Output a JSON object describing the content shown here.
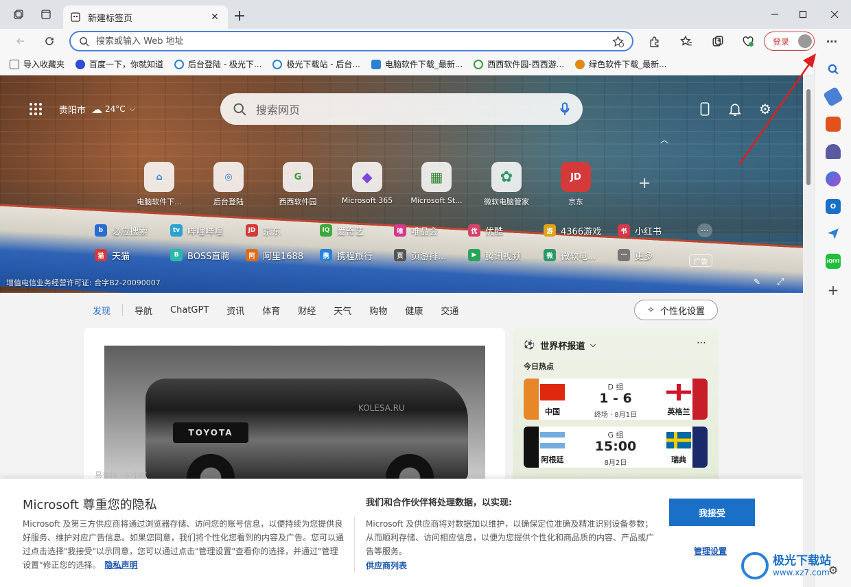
{
  "window": {
    "tab_title": "新建标签页",
    "new_tab": "+"
  },
  "address": {
    "placeholder": "搜索或输入 Web 地址"
  },
  "account": {
    "login_label": "登录"
  },
  "favorites": [
    {
      "label": "导入收藏夹",
      "color": "#555555"
    },
    {
      "label": "百度一下，你就知道",
      "color": "#2f4bd8"
    },
    {
      "label": "后台登陆 - 极光下...",
      "color": "#2a82d6"
    },
    {
      "label": "极光下载站 - 后台...",
      "color": "#2a82d6"
    },
    {
      "label": "电脑软件下载_最新...",
      "color": "#2a82d6"
    },
    {
      "label": "西西软件园-西西游...",
      "color": "#3a9a3a"
    },
    {
      "label": "绿色软件下载_最新...",
      "color": "#e08a1a"
    }
  ],
  "weather": {
    "city": "贵阳市",
    "temp": "24°C"
  },
  "hero_search": {
    "placeholder": "搜索网页"
  },
  "tiles": [
    {
      "label": "电脑软件下...",
      "glyph": "⌂",
      "color": "#2a82d6"
    },
    {
      "label": "后台登陆",
      "glyph": "◎",
      "color": "#2a82d6"
    },
    {
      "label": "西西软件园",
      "glyph": "G",
      "color": "#3a9a3a"
    },
    {
      "label": "Microsoft 365",
      "glyph": "◆",
      "color": "#7a4ad6"
    },
    {
      "label": "Microsoft St...",
      "glyph": "▦",
      "color": "#3a8a3a"
    },
    {
      "label": "微软电脑管家",
      "glyph": "✿",
      "color": "#2a9a6a"
    },
    {
      "label": "京东",
      "glyph": "JD",
      "color": "#d43a3a"
    }
  ],
  "links_row1": [
    {
      "label": "必应搜索",
      "short": "b",
      "color": "#2a6bd4"
    },
    {
      "label": "哔哩哔哩",
      "short": "tv",
      "color": "#2aa3d4"
    },
    {
      "label": "京东",
      "short": "JD",
      "color": "#d43a3a"
    },
    {
      "label": "爱奇艺",
      "short": "iQ",
      "color": "#3aaa3a"
    },
    {
      "label": "唯品会",
      "short": "唯",
      "color": "#d43a8a"
    },
    {
      "label": "优酷",
      "short": "优",
      "color": "#d4436a"
    },
    {
      "label": "4366游戏",
      "short": "游",
      "color": "#e0a21a"
    },
    {
      "label": "小红书",
      "short": "书",
      "color": "#d43a4a"
    }
  ],
  "links_row2": [
    {
      "label": "天猫",
      "short": "猫",
      "color": "#d43a3a"
    },
    {
      "label": "BOSS直聘",
      "short": "B",
      "color": "#2ab8a8"
    },
    {
      "label": "阿里1688",
      "short": "阿",
      "color": "#e06a1a"
    },
    {
      "label": "携程旅行",
      "short": "携",
      "color": "#2a82d6"
    },
    {
      "label": "页游排...",
      "short": "页",
      "color": "#555555"
    },
    {
      "label": "腾讯视频",
      "short": "▶",
      "color": "#2aa35a"
    },
    {
      "label": "微软电...",
      "short": "微",
      "color": "#2a9a6a"
    },
    {
      "label": "更多",
      "short": "⋯",
      "color": "#777777"
    }
  ],
  "ad_label": "广告",
  "icp": "增值电信业务经营许可证: 合字B2-20090007",
  "feed_nav": [
    "发现",
    "导航",
    "ChatGPT",
    "资讯",
    "体育",
    "财经",
    "天气",
    "购物",
    "健康",
    "交通"
  ],
  "personalize": "个性化设置",
  "news_card": {
    "watermark": "KOLESA.RU",
    "brand": "TOYOTA",
    "source": "易有料 · 5 小时"
  },
  "worldcup": {
    "title": "世界杯报道",
    "subtitle": "今日热点",
    "matches": [
      {
        "group": "D 组",
        "home": "中国",
        "away": "英格兰",
        "score": "1 - 6",
        "meta": "终场 · 8月1日"
      },
      {
        "group": "G 组",
        "home": "阿根廷",
        "away": "瑞典",
        "score": "15:00",
        "meta": "8月2日"
      }
    ]
  },
  "privacy": {
    "title": "Microsoft 尊重您的隐私",
    "body": "Microsoft 及第三方供应商将通过浏览器存储、访问您的账号信息，以便持续为您提供良好服务、维护对应广告信息。如果您同意，我们将个性化您看到的内容及广告。您可以通过点击选择\"我接受\"以示同意，您可以通过点击\"管理设置\"查看你的选择，并通过\"管理设置\"修正您的选择。",
    "link": "隐私声明",
    "heading2": "我们和合作伙伴将处理数据，以实现:",
    "body2": "Microsoft 及供应商将对数据加以维护，以确保定位准确及精准识别设备参数；从而顺利存储、访问相应信息，以便为您提供个性化和商品质的内容、产品或广告等服务。",
    "vendors": "供应商列表",
    "accept": "我接受",
    "manage": "管理设置"
  },
  "watermark": {
    "name": "极光下载站",
    "url": "www.xz7.com"
  },
  "sidebar_icons": [
    "search-icon",
    "tag-icon",
    "toolbox-icon",
    "chess-icon",
    "copilot-icon",
    "outlook-icon",
    "send-icon",
    "iqiyi-icon",
    "add-icon"
  ],
  "colors": {
    "accent": "#1a6fc7",
    "login_red": "#c43e3e",
    "annotation_arrow": "#e01e1e"
  }
}
